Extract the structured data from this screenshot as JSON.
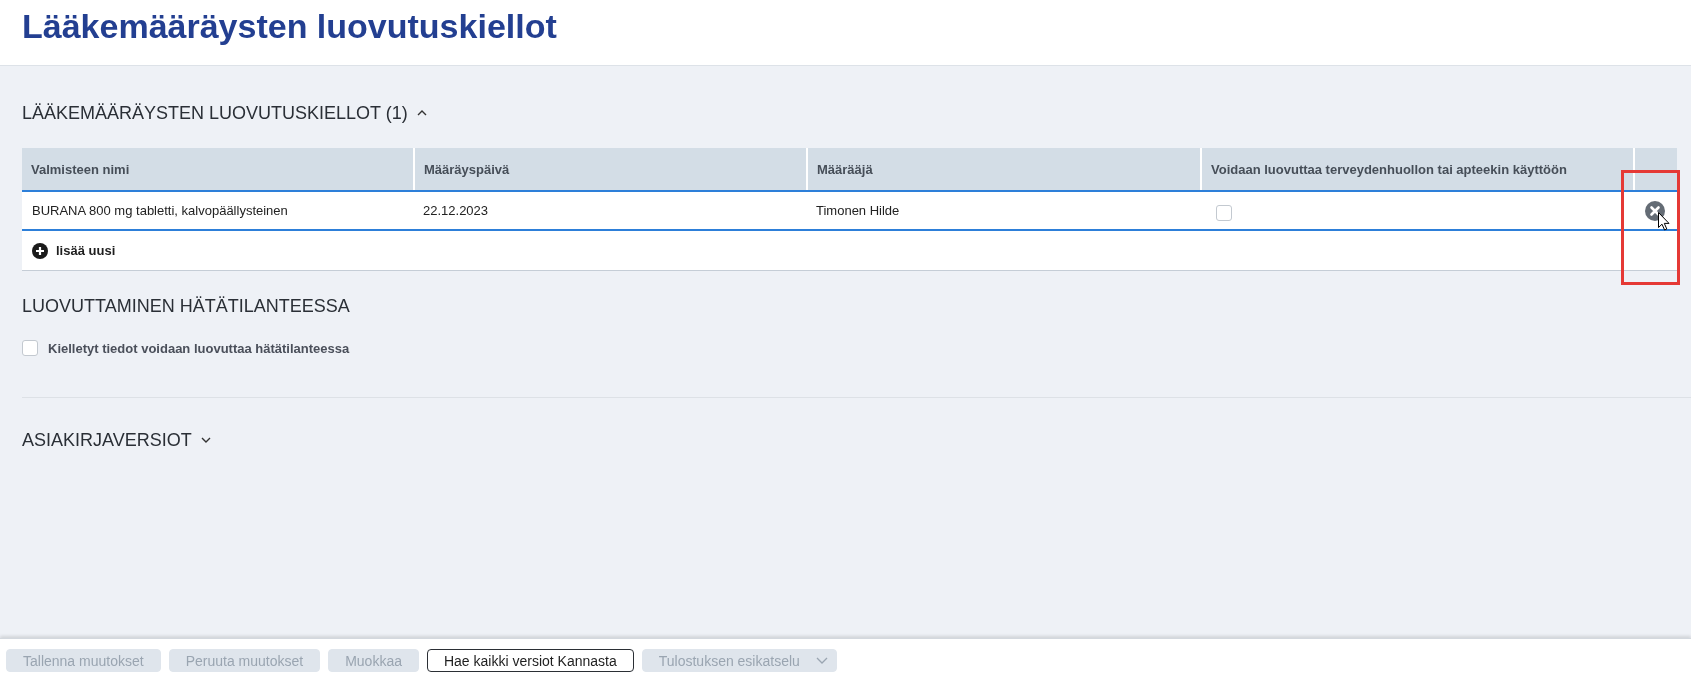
{
  "page": {
    "title": "Lääkemääräysten luovutuskiellot"
  },
  "sections": [
    {
      "kind": "table",
      "title": "LÄÄKEMÄÄRÄYSTEN LUOVUTUSKIELLOT (1)",
      "expanded": true,
      "table": {
        "columns": [
          "Valmisteen nimi",
          "Määräyspäivä",
          "Määrääjä",
          "Voidaan luovuttaa terveydenhuollon tai apteekin käyttöön"
        ],
        "rows": [
          {
            "cells": [
              "BURANA 800 mg tabletti, kalvopäällysteinen",
              "22.12.2023",
              "Timonen Hilde"
            ],
            "releasable": false,
            "remove_hovered": true,
            "remove_highlighted": true
          }
        ],
        "add_label": "lisää uusi"
      }
    },
    {
      "kind": "option",
      "title": "LUOVUTTAMINEN HÄTÄTILANTEESSA",
      "checkbox": {
        "label": "Kielletyt tiedot voidaan luovuttaa hätätilanteessa",
        "checked": false
      }
    },
    {
      "kind": "collapsible",
      "title": "ASIAKIRJAVERSIOT",
      "expanded": false
    }
  ],
  "toolbar": {
    "buttons": [
      {
        "label": "Tallenna muutokset",
        "disabled": true,
        "kind": "button"
      },
      {
        "label": "Peruuta muutokset",
        "disabled": true,
        "kind": "button"
      },
      {
        "label": "Muokkaa",
        "disabled": true,
        "kind": "button"
      },
      {
        "label": "Hae kaikki versiot Kannasta",
        "disabled": false,
        "kind": "button"
      },
      {
        "label": "Tulostuksen esikatselu",
        "disabled": true,
        "kind": "dropdown"
      }
    ]
  }
}
